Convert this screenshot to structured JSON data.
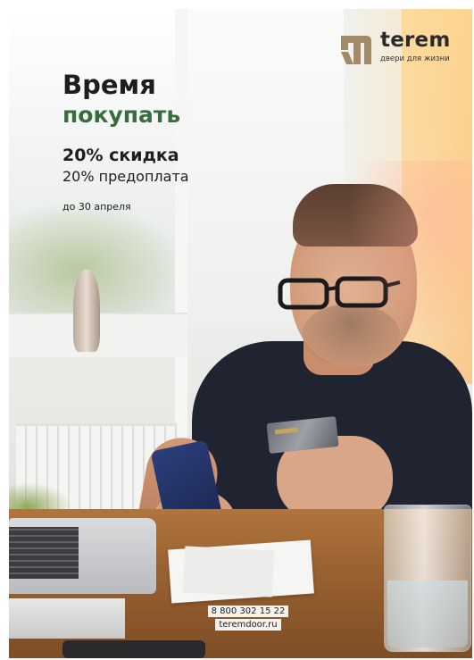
{
  "brand": {
    "name": "terem",
    "tagline": "двери для жизни",
    "logo_icon": "terem-door-mark-icon",
    "logo_color": "#a08a68"
  },
  "headline": {
    "line1": "Время",
    "line2": "покупать",
    "line2_color": "#3a6b3f"
  },
  "offer": {
    "discount": "20% скидка",
    "prepayment": "20% предоплата",
    "deadline": "до 30 апреля"
  },
  "contacts": {
    "phone": "8 800 302 15 22",
    "website": "teremdoor.ru"
  },
  "colors": {
    "text": "#1e1e1e",
    "accent_green": "#3a6b3f",
    "shirt": "#1f2430",
    "table_wood": "#9a6231"
  }
}
